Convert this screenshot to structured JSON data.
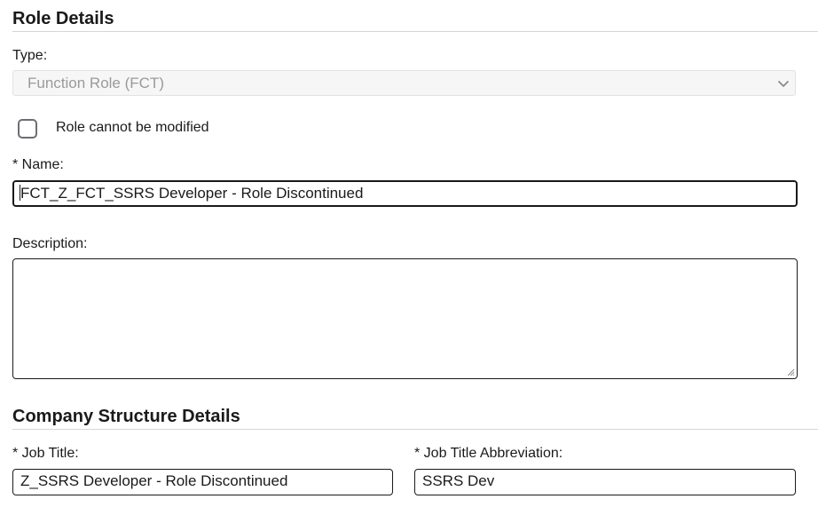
{
  "role_details": {
    "heading": "Role Details",
    "type_label": "Type:",
    "type_value": "Function Role (FCT)",
    "readonly_checkbox_label": "Role cannot be modified",
    "readonly_checked": false,
    "name_label": "* Name:",
    "name_value": "FCT_Z_FCT_SSRS Developer - Role Discontinued",
    "description_label": "Description:",
    "description_value": ""
  },
  "company_structure": {
    "heading": "Company Structure Details",
    "job_title_label": "* Job Title:",
    "job_title_value": "Z_SSRS Developer - Role Discontinued",
    "job_title_abbr_label": "* Job Title Abbreviation:",
    "job_title_abbr_value": "SSRS Dev"
  },
  "icons": {
    "select_arrow": "chevron-down-icon",
    "textarea_grip": "resize-grip-icon"
  },
  "colors": {
    "text": "#1a1a1a",
    "disabled_text": "#9a9a9a",
    "disabled_bg": "#f6f6f6",
    "rule": "#d6d6d6"
  }
}
